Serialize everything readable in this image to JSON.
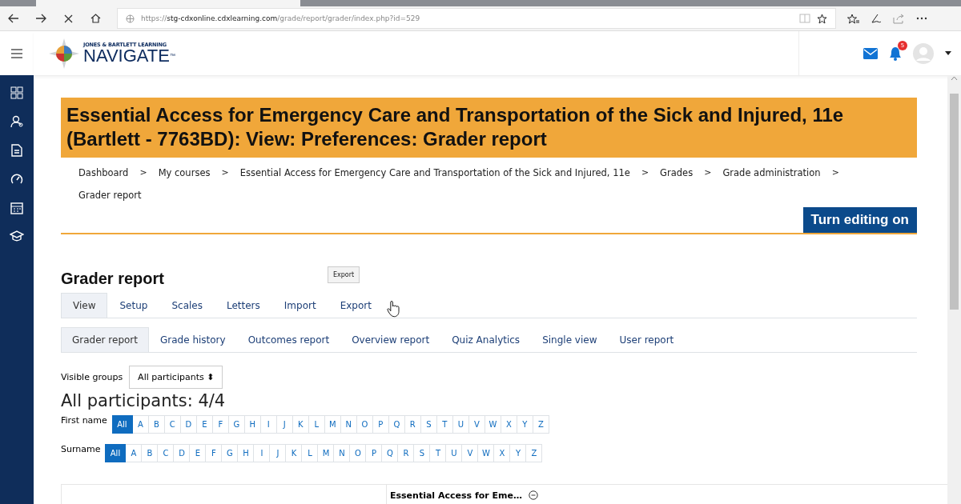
{
  "browser": {
    "url": "https://**stg-cdxonline.cdxlearning.com**/grade/report/grader/index.php?id=529",
    "loading": true
  },
  "header": {
    "logo_small": "JONES & BARTLETT LEARNING",
    "logo_big": "NAVIGATE",
    "trademark": "™",
    "notification_count": "5"
  },
  "page_title": "Essential Access for Emergency Care and Transportation of the Sick and Injured, 11e (Bartlett - 7763BD): View: Preferences: Grader report",
  "breadcrumb": [
    {
      "label": "Dashboard",
      "separator": ">"
    },
    {
      "label": "My courses",
      "separator": ">"
    },
    {
      "label": "Essential Access for Emergency Care and Transportation of the Sick and Injured, 11e",
      "separator": ">"
    },
    {
      "label": "Grades",
      "separator": ">"
    },
    {
      "label": "Grade administration",
      "separator": ">"
    },
    {
      "label": "Grader report"
    }
  ],
  "edit_button": "Turn editing on",
  "heading": "Grader report",
  "tooltip": "Export",
  "tabs": [
    {
      "label": "View",
      "selected": true
    },
    {
      "label": "Setup",
      "selected": false
    },
    {
      "label": "Scales",
      "selected": false
    },
    {
      "label": "Letters",
      "selected": false
    },
    {
      "label": "Import",
      "selected": false
    },
    {
      "label": "Export",
      "selected": false
    }
  ],
  "subtabs": [
    {
      "label": "Grader report",
      "selected": true
    },
    {
      "label": "Grade history",
      "selected": false
    },
    {
      "label": "Outcomes report",
      "selected": false
    },
    {
      "label": "Overview report",
      "selected": false
    },
    {
      "label": "Quiz Analytics",
      "selected": false
    },
    {
      "label": "Single view",
      "selected": false
    },
    {
      "label": "User report",
      "selected": false
    }
  ],
  "groups": {
    "label": "Visible groups",
    "value": "All participants",
    "caret": "⬍"
  },
  "participants": "All participants: 4/4",
  "filters": [
    {
      "label": "First name",
      "letters": [
        {
          "label": "All",
          "selected": true
        },
        {
          "label": "A",
          "selected": false
        },
        {
          "label": "B",
          "selected": false
        },
        {
          "label": "C",
          "selected": false
        },
        {
          "label": "D",
          "selected": false
        },
        {
          "label": "E",
          "selected": false
        },
        {
          "label": "F",
          "selected": false
        },
        {
          "label": "G",
          "selected": false
        },
        {
          "label": "H",
          "selected": false
        },
        {
          "label": "I",
          "selected": false
        },
        {
          "label": "J",
          "selected": false
        },
        {
          "label": "K",
          "selected": false
        },
        {
          "label": "L",
          "selected": false
        },
        {
          "label": "M",
          "selected": false
        },
        {
          "label": "N",
          "selected": false
        },
        {
          "label": "O",
          "selected": false
        },
        {
          "label": "P",
          "selected": false
        },
        {
          "label": "Q",
          "selected": false
        },
        {
          "label": "R",
          "selected": false
        },
        {
          "label": "S",
          "selected": false
        },
        {
          "label": "T",
          "selected": false
        },
        {
          "label": "U",
          "selected": false
        },
        {
          "label": "V",
          "selected": false
        },
        {
          "label": "W",
          "selected": false
        },
        {
          "label": "X",
          "selected": false
        },
        {
          "label": "Y",
          "selected": false
        },
        {
          "label": "Z",
          "selected": false
        }
      ]
    },
    {
      "label": "Surname",
      "letters": [
        {
          "label": "All",
          "selected": true
        },
        {
          "label": "A",
          "selected": false
        },
        {
          "label": "B",
          "selected": false
        },
        {
          "label": "C",
          "selected": false
        },
        {
          "label": "D",
          "selected": false
        },
        {
          "label": "E",
          "selected": false
        },
        {
          "label": "F",
          "selected": false
        },
        {
          "label": "G",
          "selected": false
        },
        {
          "label": "H",
          "selected": false
        },
        {
          "label": "I",
          "selected": false
        },
        {
          "label": "J",
          "selected": false
        },
        {
          "label": "K",
          "selected": false
        },
        {
          "label": "L",
          "selected": false
        },
        {
          "label": "M",
          "selected": false
        },
        {
          "label": "N",
          "selected": false
        },
        {
          "label": "O",
          "selected": false
        },
        {
          "label": "P",
          "selected": false
        },
        {
          "label": "Q",
          "selected": false
        },
        {
          "label": "R",
          "selected": false
        },
        {
          "label": "S",
          "selected": false
        },
        {
          "label": "T",
          "selected": false
        },
        {
          "label": "U",
          "selected": false
        },
        {
          "label": "V",
          "selected": false
        },
        {
          "label": "W",
          "selected": false
        },
        {
          "label": "X",
          "selected": false
        },
        {
          "label": "Y",
          "selected": false
        },
        {
          "label": "Z",
          "selected": false
        }
      ]
    }
  ],
  "table": {
    "column_2": "Essential Access for Eme…"
  }
}
